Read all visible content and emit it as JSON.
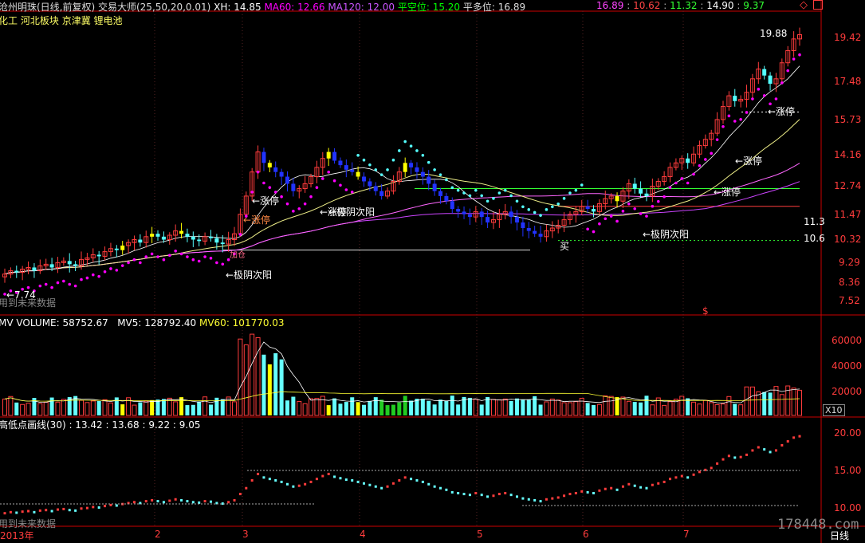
{
  "header": {
    "title": "沧州明珠(日线,前复权) 交易大师(25,50,20,0.01)",
    "xh": "XH: 14.85",
    "ma60": "MA60: 12.66",
    "ma120": "MA120: 12.00",
    "kong": "平空位: 15.20",
    "duo": "平多位: 16.89",
    "r1": "16.89",
    "r2": "10.62",
    "r3": "11.32",
    "r4": "14.90",
    "r5": "9.37",
    "diamond": "◇"
  },
  "tags": [
    "化工",
    "河北板块",
    "京津冀",
    "锂电池"
  ],
  "colors": {
    "up": "#ff3c3c",
    "down": "#54ffff",
    "yellow": "#ffff00",
    "magenta": "#ff00ff",
    "bg": "#000000"
  },
  "price_axis": [
    "19.42",
    "17.48",
    "15.73",
    "14.16",
    "12.74",
    "11.47",
    "10.32",
    "9.29",
    "8.36",
    "7.52"
  ],
  "right_labels": {
    "p11": "11.3",
    "p10": "10.6"
  },
  "annotations": {
    "high": "19.88",
    "low": "←7.74",
    "limit_up_1": "←涨停",
    "limit_up_2": "←涨停",
    "limit_up_3": "←涨停",
    "limit_up_4": "←涨停",
    "limit_up_5": "←涨停",
    "limit_up_6": "←涨停",
    "yin_1": "←极阴次阳",
    "yin_2": "←极阴次阳",
    "yin_3": "←极阴次阳",
    "buy": "买",
    "jiaxin": "加仓",
    "future_1": "用到未来数据",
    "future_2": "用到未来数据",
    "dollar": "$"
  },
  "volume": {
    "title": "MV VOLUME: 58752.67",
    "mv5": "MV5: 128792.40",
    "mv60": "MV60: 101770.03",
    "axis": [
      "60000",
      "40000",
      "20000"
    ],
    "unit": "X10"
  },
  "indicator": {
    "title": "高低点画线(30) : 13.42 : 13.68 : 9.22 : 9.05",
    "axis": [
      "20.00",
      "15.00",
      "10.00"
    ]
  },
  "time_axis": [
    "2013年",
    "2",
    "3",
    "4",
    "5",
    "6",
    "7"
  ],
  "period": "日线",
  "watermark": "178448.com",
  "chart_data": {
    "type": "candlestick",
    "title": "沧州明珠(日线,前复权)",
    "ylim": [
      7.52,
      19.9
    ],
    "y_scale": "log",
    "closes": [
      8.3,
      8.4,
      8.35,
      8.45,
      8.5,
      8.4,
      8.55,
      8.6,
      8.5,
      8.65,
      8.7,
      8.6,
      8.55,
      8.75,
      8.8,
      8.9,
      8.85,
      9.0,
      9.1,
      9.05,
      9.2,
      9.3,
      9.4,
      9.3,
      9.5,
      9.6,
      9.5,
      9.4,
      9.55,
      9.7,
      9.6,
      9.5,
      9.4,
      9.35,
      9.5,
      9.45,
      9.3,
      9.25,
      9.4,
      9.6,
      10.3,
      11.0,
      12.0,
      12.9,
      12.4,
      12.2,
      12.0,
      11.8,
      11.5,
      11.2,
      11.3,
      11.5,
      11.8,
      12.2,
      12.6,
      12.9,
      12.5,
      12.3,
      12.1,
      12.0,
      11.8,
      11.6,
      11.4,
      11.2,
      11.0,
      11.2,
      11.6,
      12.0,
      12.4,
      12.2,
      12.0,
      11.8,
      11.5,
      11.2,
      11.0,
      10.8,
      10.5,
      10.4,
      10.3,
      10.2,
      10.4,
      10.2,
      10.0,
      10.1,
      10.3,
      10.4,
      10.2,
      10.0,
      9.8,
      9.7,
      9.6,
      9.5,
      9.7,
      9.8,
      9.9,
      10.1,
      10.3,
      10.4,
      10.6,
      10.5,
      10.4,
      10.7,
      10.9,
      11.0,
      10.8,
      11.2,
      11.5,
      11.3,
      11.1,
      11.0,
      11.4,
      11.6,
      11.8,
      12.2,
      12.4,
      12.6,
      12.4,
      12.8,
      13.2,
      13.5,
      13.8,
      14.5,
      15.2,
      15.8,
      15.5,
      15.6,
      16.0,
      16.8,
      17.4,
      17.0,
      16.5,
      16.8,
      17.8,
      18.6,
      19.4,
      19.7
    ],
    "volume_unit": "X10",
    "series": [
      {
        "name": "MV5",
        "last": 128792.4
      },
      {
        "name": "MV60",
        "last": 101770.03
      }
    ]
  }
}
